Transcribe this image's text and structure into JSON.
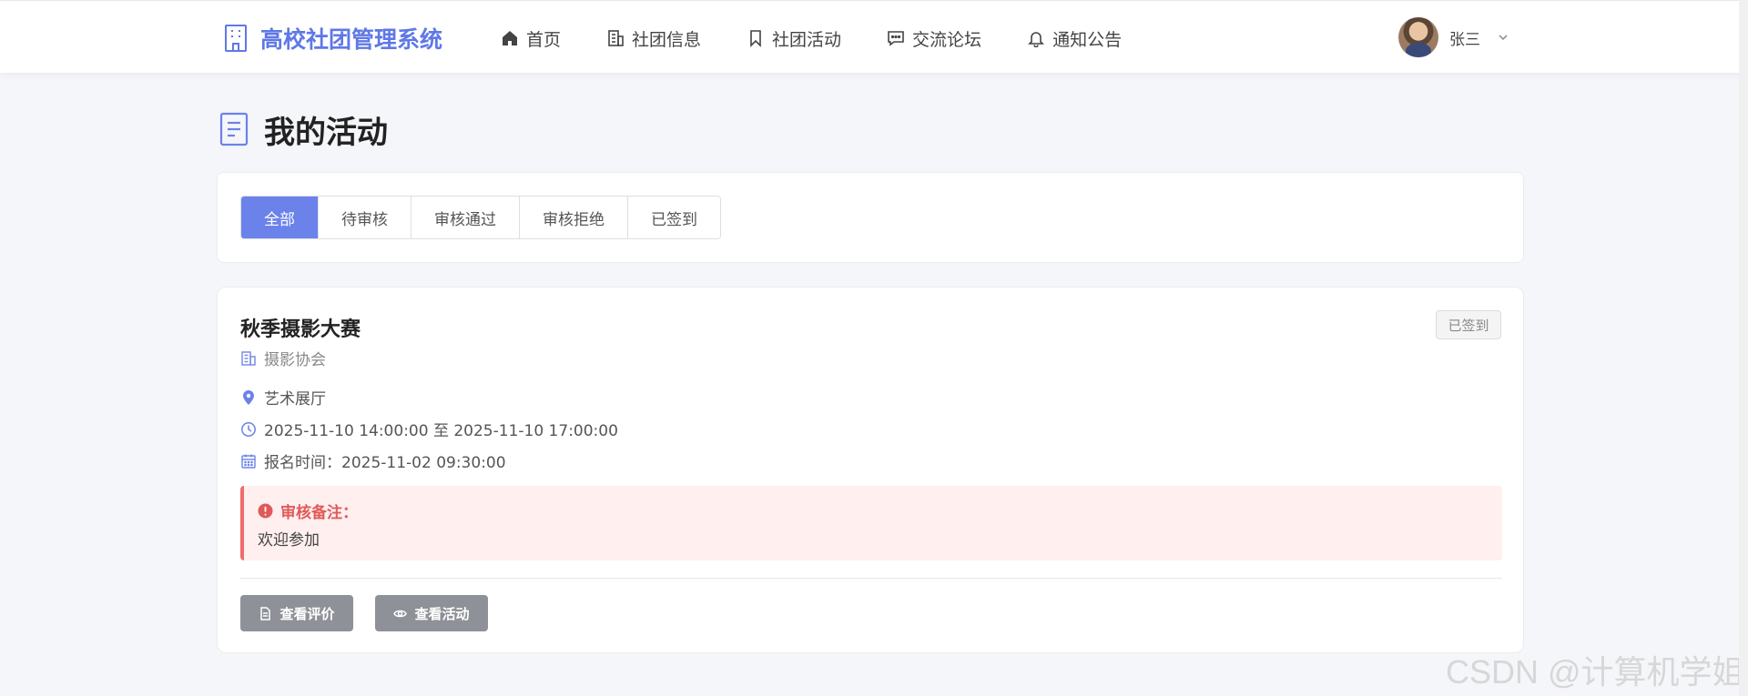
{
  "header": {
    "brand": "高校社团管理系统",
    "nav": [
      {
        "label": "首页",
        "icon": "home-icon"
      },
      {
        "label": "社团信息",
        "icon": "building-icon"
      },
      {
        "label": "社团活动",
        "icon": "bookmark-icon"
      },
      {
        "label": "交流论坛",
        "icon": "chat-icon"
      },
      {
        "label": "通知公告",
        "icon": "bell-icon"
      }
    ],
    "user_name": "张三"
  },
  "page": {
    "title": "我的活动"
  },
  "tabs": [
    {
      "label": "全部",
      "active": true
    },
    {
      "label": "待审核",
      "active": false
    },
    {
      "label": "审核通过",
      "active": false
    },
    {
      "label": "审核拒绝",
      "active": false
    },
    {
      "label": "已签到",
      "active": false
    }
  ],
  "activity": {
    "title": "秋季摄影大赛",
    "club": "摄影协会",
    "status": "已签到",
    "location": "艺术展厅",
    "time_range": "2025-11-10 14:00:00 至 2025-11-10 17:00:00",
    "signup_time": "报名时间：2025-11-02 09:30:00",
    "note_title": "审核备注：",
    "note_text": "欢迎参加",
    "btn_review": "查看评价",
    "btn_view": "查看活动"
  },
  "watermark": "CSDN @计算机学姐",
  "colors": {
    "accent": "#6b82ea",
    "brand": "#5f78e6",
    "danger": "#f06b6b",
    "note_bg": "#ffefef",
    "button_gray": "#8e9197"
  }
}
